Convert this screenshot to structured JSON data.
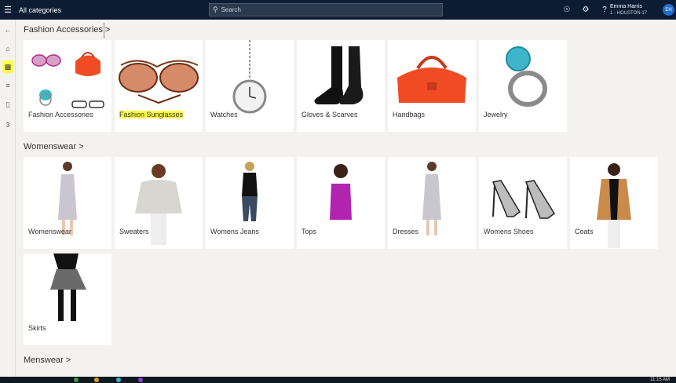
{
  "topbar": {
    "title": "All categories",
    "search_placeholder": "Search"
  },
  "user": {
    "name": "Emma Harris",
    "store": "1 - HOUSTON-17",
    "initials": "EH"
  },
  "leftbar": {
    "cart_count": "3"
  },
  "sections": [
    {
      "title": "Fashion Accessories >",
      "tiles": [
        "Fashion Accessories",
        "Fashion Sunglasses",
        "Watches",
        "Gloves & Scarves",
        "Handbags",
        "Jewelry"
      ]
    },
    {
      "title": "Womenswear >",
      "tiles": [
        "Womenswear",
        "Sweaters",
        "Womens Jeans",
        "Tops",
        "Dresses",
        "Womens Shoes",
        "Coats",
        "Skirts"
      ]
    },
    {
      "title": "Menswear >"
    }
  ],
  "taskbar": {
    "time": "11:15 AM"
  },
  "colors": {
    "topbar": "#0c1c33",
    "highlight": "#ffff4a",
    "accent": "#1f6ec9"
  }
}
